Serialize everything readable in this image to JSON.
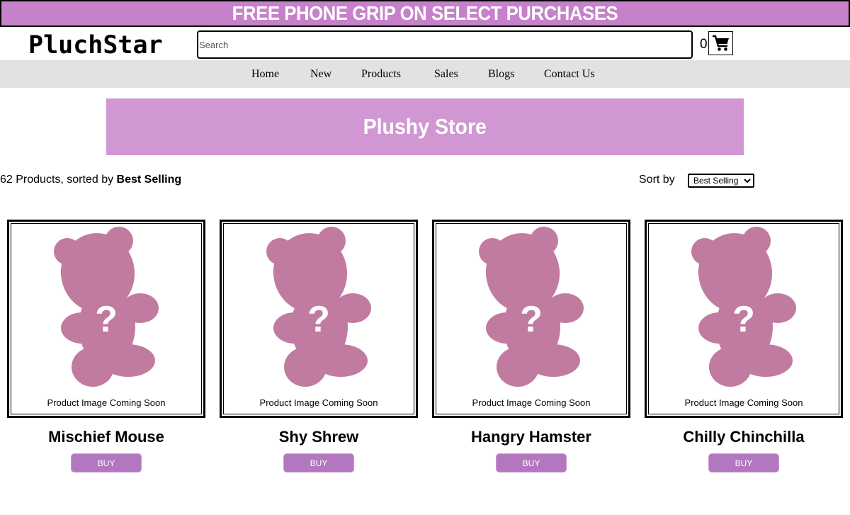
{
  "promo": {
    "text": "FREE PHONE GRIP ON SELECT PURCHASES"
  },
  "header": {
    "logo": "PluchStar",
    "search_placeholder": "Search",
    "cart_count": "0",
    "cart_icon": "cart-icon"
  },
  "nav": {
    "items": [
      "Home",
      "New",
      "Products",
      "Sales",
      "Blogs",
      "Contact Us"
    ]
  },
  "banner": {
    "title": "Plushy Store"
  },
  "results": {
    "summary_prefix": "62 Products, sorted by",
    "summary_sort": "Best Selling",
    "sort_label": "Sort by",
    "sort_selected": "Best Selling"
  },
  "products": [
    {
      "name": "Mischief Mouse",
      "image_text": "Product Image Coming Soon",
      "buy_label": "BUY"
    },
    {
      "name": "Shy Shrew",
      "image_text": "Product Image Coming Soon",
      "buy_label": "BUY"
    },
    {
      "name": "Hangry Hamster",
      "image_text": "Product Image Coming Soon",
      "buy_label": "BUY"
    },
    {
      "name": "Chilly Chinchilla",
      "image_text": "Product Image Coming Soon",
      "buy_label": "BUY"
    }
  ],
  "colors": {
    "promo_bg": "#c581c9",
    "banner_bg": "#d197d3",
    "bear_fill": "#c27ba0",
    "buy_button": "#b377bf",
    "nav_bg": "#e2e2e2"
  }
}
